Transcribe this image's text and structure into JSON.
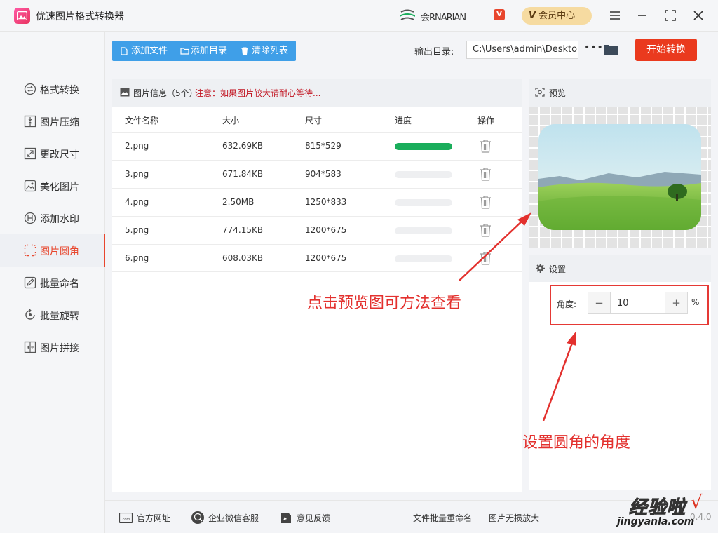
{
  "app": {
    "title": "优速图片格式转换器"
  },
  "header": {
    "user_name": "会RNARIAN",
    "vip_badge": "V",
    "vip_label": "会员中心",
    "vip_prefix": "V"
  },
  "sidebar": {
    "items": [
      {
        "label": "格式转换",
        "icon": "format-convert-icon"
      },
      {
        "label": "图片压缩",
        "icon": "compress-icon"
      },
      {
        "label": "更改尺寸",
        "icon": "resize-icon"
      },
      {
        "label": "美化图片",
        "icon": "beautify-icon"
      },
      {
        "label": "添加水印",
        "icon": "watermark-icon"
      },
      {
        "label": "图片圆角",
        "icon": "round-corner-icon"
      },
      {
        "label": "批量命名",
        "icon": "rename-icon"
      },
      {
        "label": "批量旋转",
        "icon": "rotate-icon"
      },
      {
        "label": "图片拼接",
        "icon": "splice-icon"
      }
    ],
    "active": "图片圆角"
  },
  "toolbar": {
    "add_file": "添加文件",
    "add_dir": "添加目录",
    "clear_list": "清除列表",
    "output_label": "输出目录:",
    "output_path": "C:\\Users\\admin\\Desktop",
    "more": "•••",
    "start": "开始转换"
  },
  "file_panel": {
    "title": "图片信息（5个）",
    "warning": "注意：如果图片较大请耐心等待...",
    "columns": [
      "文件名称",
      "大小",
      "尺寸",
      "进度",
      "操作"
    ],
    "rows": [
      {
        "name": "2.png",
        "size": "632.69KB",
        "dims": "815*529",
        "progress": 1.0
      },
      {
        "name": "3.png",
        "size": "671.84KB",
        "dims": "904*583",
        "progress": 0
      },
      {
        "name": "4.png",
        "size": "2.50MB",
        "dims": "1250*833",
        "progress": 0
      },
      {
        "name": "5.png",
        "size": "774.15KB",
        "dims": "1200*675",
        "progress": 0
      },
      {
        "name": "6.png",
        "size": "608.03KB",
        "dims": "1200*675",
        "progress": 0
      }
    ]
  },
  "preview": {
    "title": "预览"
  },
  "settings": {
    "title": "设置",
    "angle_label": "角度:",
    "angle_value": "10",
    "unit": "%",
    "minus": "−",
    "plus": "+"
  },
  "annotations": {
    "preview_note": "点击预览图可方法查看",
    "angle_note": "设置圆角的角度"
  },
  "footer": {
    "website": "官方网址",
    "wechat": "企业微信客服",
    "feedback": "意见反馈",
    "batch_rename": "文件批量重命名",
    "lossless": "图片无损放大",
    "version_partial": "0.4.0"
  },
  "watermark": {
    "line1": "经验啦",
    "check": "√",
    "line2": "jingyanla.com"
  },
  "colors": {
    "accent": "#e8462d",
    "toolbar_blue": "#3f9fe8",
    "progress_green": "#1aad5b",
    "annotation_red": "#e3312e"
  }
}
